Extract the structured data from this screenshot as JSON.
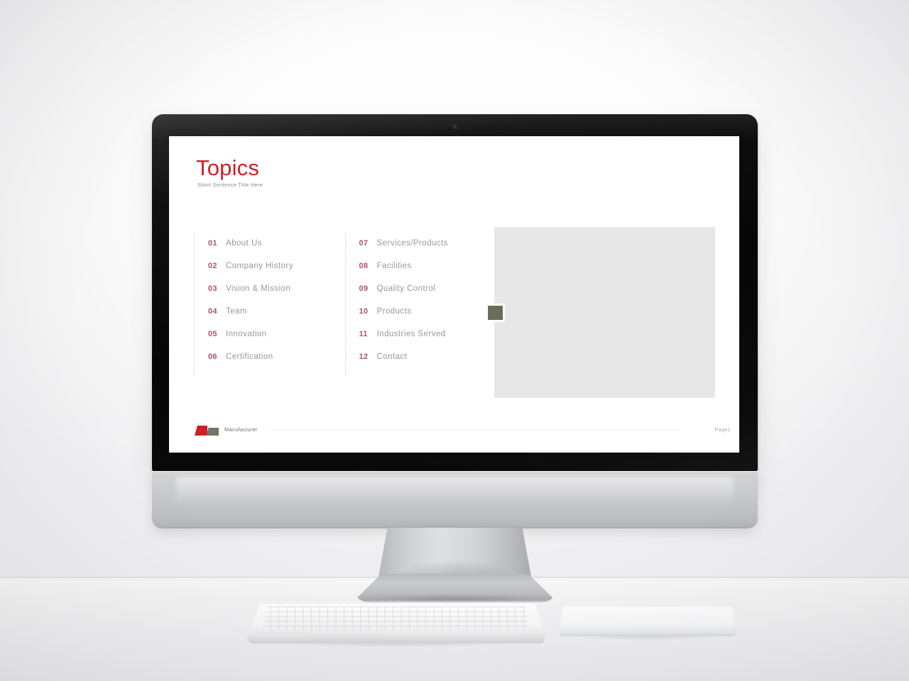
{
  "slide": {
    "title": "Topics",
    "subtitle": "Short Sentence Title Here",
    "accent_red": "#cc2128",
    "number_color": "#a85565",
    "label_color": "#9b9698",
    "media_placeholder_color": "#e7e7e7",
    "marker_color": "#6b6d58",
    "toc": {
      "left_column": [
        {
          "num": "01",
          "label": "About  Us"
        },
        {
          "num": "02",
          "label": "Company  History"
        },
        {
          "num": "03",
          "label": "Vision  &  Mission"
        },
        {
          "num": "04",
          "label": "Team"
        },
        {
          "num": "05",
          "label": "Innovation"
        },
        {
          "num": "06",
          "label": "Certification"
        }
      ],
      "right_column": [
        {
          "num": "07",
          "label": "Services/Products"
        },
        {
          "num": "08",
          "label": "Facilities"
        },
        {
          "num": "09",
          "label": "Quality  Control"
        },
        {
          "num": "10",
          "label": "Products"
        },
        {
          "num": "11",
          "label": "Industries  Served"
        },
        {
          "num": "12",
          "label": "Contact"
        }
      ]
    },
    "footer": {
      "logo_name": "Manufacturer",
      "logo_red_color": "#cc1f26",
      "logo_olive_color": "#73746a",
      "page_label": "Page1"
    }
  },
  "device": {
    "type": "desktop-all-in-one",
    "camera_icon": "camera-dot-icon",
    "peripherals": [
      "keyboard",
      "trackpad"
    ]
  }
}
